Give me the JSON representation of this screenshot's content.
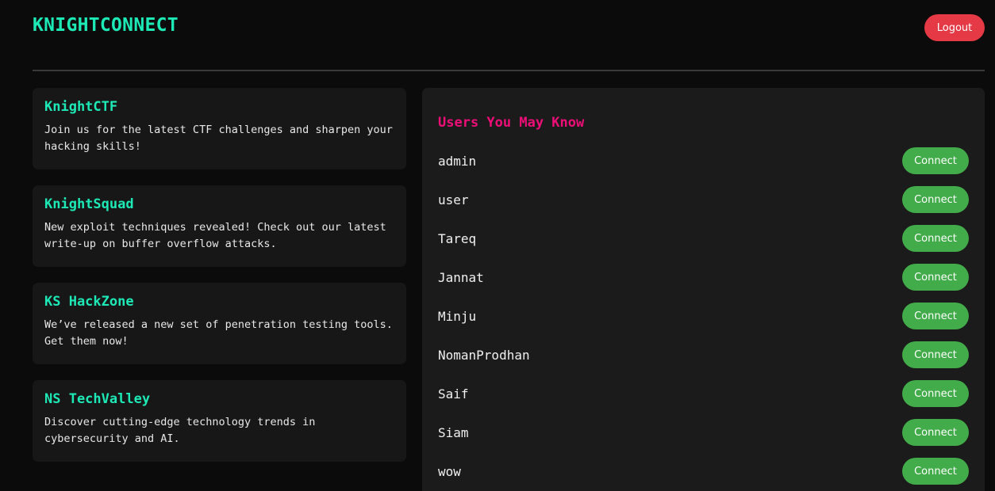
{
  "header": {
    "logo": "KNIGHTCONNECT",
    "logout_label": "Logout"
  },
  "posts": [
    {
      "title": "KnightCTF",
      "text": "Join us for the latest CTF challenges and sharpen your hacking skills!"
    },
    {
      "title": "KnightSquad",
      "text": "New exploit techniques revealed! Check out our latest write-up on buffer overflow attacks."
    },
    {
      "title": "KS HackZone",
      "text": "We’ve released a new set of penetration testing tools. Get them now!"
    },
    {
      "title": "NS TechValley",
      "text": "Discover cutting-edge technology trends in cybersecurity and AI."
    }
  ],
  "users_panel": {
    "title": "Users You May Know",
    "connect_label": "Connect",
    "users": [
      "admin",
      "user",
      "Tareq",
      "Jannat",
      "Minju",
      "NomanProdhan",
      "Saif",
      "Siam",
      "wow"
    ]
  },
  "colors": {
    "background": "#0b0b0b",
    "accent_teal": "#1de9b6",
    "accent_pink": "#ef0e78",
    "logout_red": "#e53945",
    "connect_green": "#43ac4a"
  }
}
